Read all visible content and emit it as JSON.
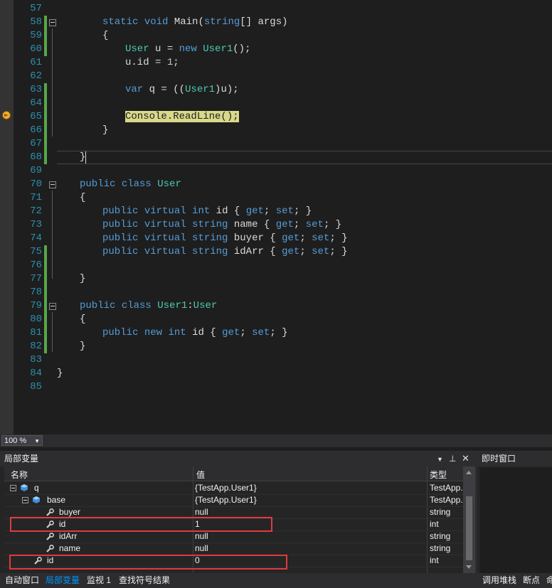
{
  "editor": {
    "lines": [
      {
        "n": "57",
        "code": ""
      },
      {
        "n": "58",
        "code": "static void Main(string[] args)"
      },
      {
        "n": "59",
        "code": "{"
      },
      {
        "n": "60",
        "code": "User u = new User1();"
      },
      {
        "n": "61",
        "code": "u.id = 1;"
      },
      {
        "n": "62",
        "code": ""
      },
      {
        "n": "63",
        "code": "var q = ((User1)u);"
      },
      {
        "n": "64",
        "code": ""
      },
      {
        "n": "65",
        "code": "Console.ReadLine();"
      },
      {
        "n": "66",
        "code": "}"
      },
      {
        "n": "67",
        "code": ""
      },
      {
        "n": "68",
        "code": "}"
      },
      {
        "n": "69",
        "code": ""
      },
      {
        "n": "70",
        "code": "public class User"
      },
      {
        "n": "71",
        "code": "{"
      },
      {
        "n": "72",
        "code": "public virtual int id { get; set; }"
      },
      {
        "n": "73",
        "code": "public virtual string name { get; set; }"
      },
      {
        "n": "74",
        "code": "public virtual string buyer { get; set; }"
      },
      {
        "n": "75",
        "code": "public virtual string idArr { get; set; }"
      },
      {
        "n": "76",
        "code": ""
      },
      {
        "n": "77",
        "code": "}"
      },
      {
        "n": "78",
        "code": ""
      },
      {
        "n": "79",
        "code": "public class User1:User"
      },
      {
        "n": "80",
        "code": "{"
      },
      {
        "n": "81",
        "code": "public new int id { get; set; }"
      },
      {
        "n": "82",
        "code": "}"
      },
      {
        "n": "83",
        "code": ""
      },
      {
        "n": "84",
        "code": "}"
      },
      {
        "n": "85",
        "code": ""
      }
    ]
  },
  "zoom": {
    "value": "100 %"
  },
  "locals": {
    "title": "局部变量",
    "columns": {
      "name": "名称",
      "value": "值",
      "type": "类型"
    },
    "rows": [
      {
        "name": "q",
        "value": "{TestApp.User1}",
        "type": "TestApp."
      },
      {
        "name": "base",
        "value": "{TestApp.User1}",
        "type": "TestApp."
      },
      {
        "name": "buyer",
        "value": "null",
        "type": "string"
      },
      {
        "name": "id",
        "value": "1",
        "type": "int"
      },
      {
        "name": "idArr",
        "value": "null",
        "type": "string"
      },
      {
        "name": "name",
        "value": "null",
        "type": "string"
      },
      {
        "name": "id",
        "value": "0",
        "type": "int"
      }
    ]
  },
  "immediate": {
    "title": "即时窗口"
  },
  "bottom_tabs": {
    "left": [
      "自动窗口",
      "局部变量",
      "监视 1",
      "查找符号结果"
    ],
    "right": [
      "调用堆栈",
      "断点",
      "命"
    ]
  },
  "colors": {
    "keyword": "#569cd6",
    "type": "#4ec9b0",
    "number": "#b5cea8",
    "active_tab": "#0097fb",
    "highlight_box": "#e23a3a"
  }
}
